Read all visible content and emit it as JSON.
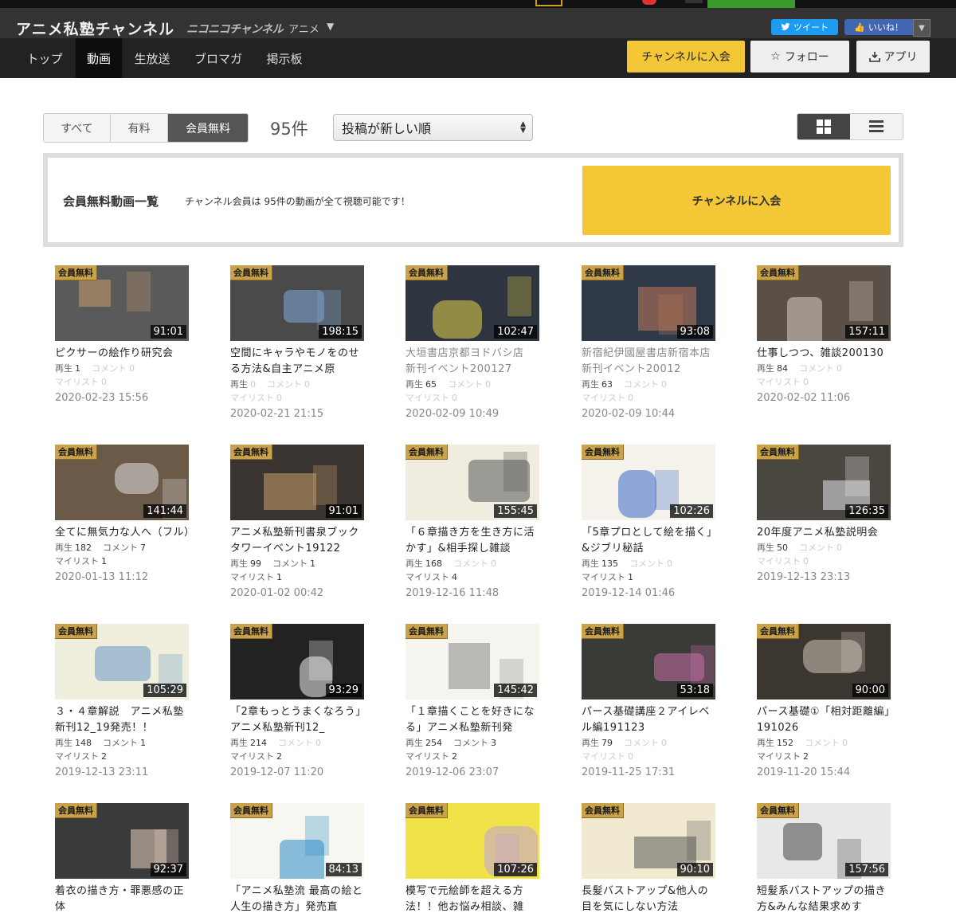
{
  "channel": {
    "title": "アニメ私塾チャンネル",
    "service": "ニコニコチャンネル",
    "genre": "アニメ"
  },
  "social": {
    "tweet": "ツイート",
    "like": "いいね！"
  },
  "nav": [
    "トップ",
    "動画",
    "生放送",
    "ブロマガ",
    "掲示板"
  ],
  "actions": {
    "join": "チャンネルに入会",
    "follow": "フォロー",
    "app": "アプリ"
  },
  "filter": {
    "tabs": [
      "すべて",
      "有料",
      "会員無料"
    ],
    "active": 2,
    "count": "95件",
    "sort": "投稿が新しい順"
  },
  "promo": {
    "title": "会員無料動画一覧",
    "desc": "チャンネル会員は 95件の動画が全て視聴可能です！",
    "join": "チャンネルに入会"
  },
  "labels": {
    "badge": "会員無料",
    "plays": "再生",
    "comments": "コメント",
    "mylist": "マイリスト"
  },
  "videos": [
    {
      "dur": "91:01",
      "title": "ピクサーの絵作り研究会",
      "plays": "1",
      "comments": "0",
      "mylist": "0",
      "date": "2020-02-23 15:56",
      "grey": false,
      "bg": "#5a5a5a",
      "accent": "#c9a070"
    },
    {
      "dur": "198:15",
      "title": "空間にキャラやモノをのせる方法&自主アニメ原",
      "plays": "0",
      "comments": "0",
      "mylist": "0",
      "date": "2020-02-21 21:15",
      "grey": false,
      "bg": "#4a4a4a",
      "accent": "#7fa8d8"
    },
    {
      "dur": "102:47",
      "title": "大垣書店京都ヨドバシ店　新刊イベント200127",
      "plays": "65",
      "comments": "0",
      "mylist": "0",
      "date": "2020-02-09 10:49",
      "grey": true,
      "bg": "#2e3540",
      "accent": "#e6d24a"
    },
    {
      "dur": "93:08",
      "title": "新宿紀伊國屋書店新宿本店　新刊イベント20012",
      "plays": "63",
      "comments": "0",
      "mylist": "0",
      "date": "2020-02-09 10:44",
      "grey": true,
      "bg": "#2f3948",
      "accent": "#c07a5a"
    },
    {
      "dur": "157:11",
      "title": "仕事しつつ、雑談200130",
      "plays": "84",
      "comments": "0",
      "mylist": "0",
      "date": "2020-02-02 11:06",
      "grey": false,
      "bg": "#5b5048",
      "accent": "#d8cfc4"
    },
    {
      "dur": "141:44",
      "title": "全てに無気力な人へ（フル）",
      "plays": "182",
      "comments": "7",
      "mylist": "1",
      "date": "2020-01-13 11:12",
      "grey": false,
      "bg": "#6b5a48",
      "accent": "#e0e0e0"
    },
    {
      "dur": "91:01",
      "title": "アニメ私塾新刊書泉ブックタワーイベント19122",
      "plays": "99",
      "comments": "1",
      "mylist": "1",
      "date": "2020-01-02 00:42",
      "grey": false,
      "bg": "#3a3430",
      "accent": "#c8a06a"
    },
    {
      "dur": "155:45",
      "title": "「６章描き方を生き方に活かす」&相手探し雑談",
      "plays": "168",
      "comments": "0",
      "mylist": "4",
      "date": "2019-12-16 11:48",
      "grey": false,
      "bg": "#f0ede0",
      "accent": "#555555"
    },
    {
      "dur": "102:26",
      "title": "「5章プロとして絵を描く」&ジブリ秘話",
      "plays": "135",
      "comments": "0",
      "mylist": "1",
      "date": "2019-12-14 01:46",
      "grey": false,
      "bg": "#f4f2ea",
      "accent": "#3a6ac8"
    },
    {
      "dur": "126:35",
      "title": "20年度アニメ私塾説明会",
      "plays": "50",
      "comments": "0",
      "mylist": "0",
      "date": "2019-12-13 23:13",
      "grey": false,
      "bg": "#4a4640",
      "accent": "#e8e8e8"
    },
    {
      "dur": "105:29",
      "title": "３・４章解説　アニメ私塾新刊12_19発売！！",
      "plays": "148",
      "comments": "1",
      "mylist": "2",
      "date": "2019-12-13 23:11",
      "grey": false,
      "bg": "#f0eedc",
      "accent": "#6a9ac8"
    },
    {
      "dur": "93:29",
      "title": "「2章もっとうまくなろう」アニメ私塾新刊12_",
      "plays": "214",
      "comments": "0",
      "mylist": "2",
      "date": "2019-12-07 11:20",
      "grey": false,
      "bg": "#222222",
      "accent": "#f2f2f2"
    },
    {
      "dur": "145:42",
      "title": "「１章描くことを好きになる」アニメ私塾新刊発",
      "plays": "254",
      "comments": "3",
      "mylist": "2",
      "date": "2019-12-06 23:07",
      "grey": false,
      "bg": "#f6f4ee",
      "accent": "#888888"
    },
    {
      "dur": "53:18",
      "title": "パース基礎講座２アイレベル編191123",
      "plays": "79",
      "comments": "0",
      "mylist": "0",
      "date": "2019-11-25 17:31",
      "grey": false,
      "bg": "#3a3a36",
      "accent": "#c870a8"
    },
    {
      "dur": "90:00",
      "title": "パース基礎①「相対距離編」191026",
      "plays": "152",
      "comments": "0",
      "mylist": "2",
      "date": "2019-11-20 15:44",
      "grey": false,
      "bg": "#3c3630",
      "accent": "#d0c8b8"
    },
    {
      "dur": "92:37",
      "title": "着衣の描き方・罪悪感の正体",
      "plays": "",
      "comments": "",
      "mylist": "",
      "date": "",
      "grey": false,
      "bg": "#3a3a3a",
      "accent": "#e8d0c0"
    },
    {
      "dur": "84:13",
      "title": "「アニメ私塾流 最高の絵と人生の描き方」発売直",
      "plays": "",
      "comments": "",
      "mylist": "",
      "date": "",
      "grey": false,
      "bg": "#f8f6f0",
      "accent": "#2a8ac8"
    },
    {
      "dur": "107:26",
      "title": "模写で元絵師を超える方法！！他お悩み相談、雑",
      "plays": "",
      "comments": "",
      "mylist": "",
      "date": "",
      "grey": false,
      "bg": "#f2e24a",
      "accent": "#c0a0d8"
    },
    {
      "dur": "90:10",
      "title": "長髪バストアップ&他人の目を気にしない方法",
      "plays": "",
      "comments": "",
      "mylist": "",
      "date": "",
      "grey": false,
      "bg": "#f2ead0",
      "accent": "#555555"
    },
    {
      "dur": "157:56",
      "title": "短髪系バストアップの描き方&みんな結果求めす",
      "plays": "",
      "comments": "",
      "mylist": "",
      "date": "",
      "grey": false,
      "bg": "#e8e8e8",
      "accent": "#444444"
    }
  ]
}
